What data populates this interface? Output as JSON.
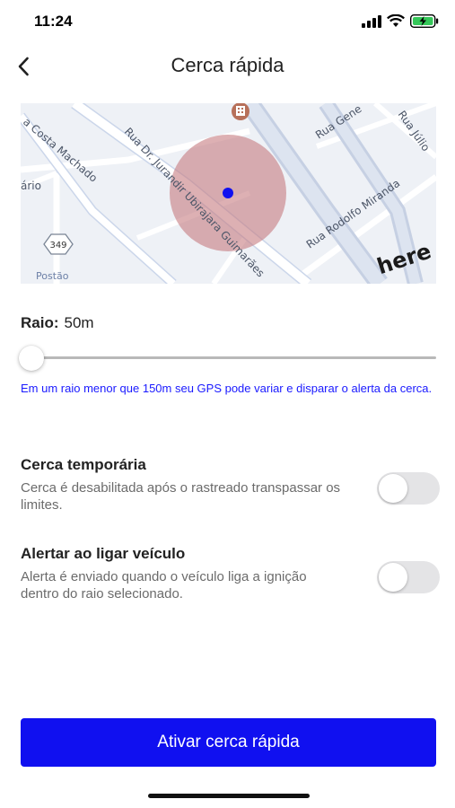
{
  "status": {
    "time": "11:24"
  },
  "header": {
    "title": "Cerca rápida"
  },
  "map": {
    "streets": {
      "costa_machado": "a Costa Machado",
      "jurandir": "Rua Dr. Jurandir Ubirajara Guimarães",
      "genebra": "Rua Gene",
      "julio": "Rua Júlio",
      "rodolfo": "Rua Rodolfo Miranda",
      "rosario": "ário",
      "postao": "Postão",
      "route": "349"
    },
    "brand": "here",
    "colors": {
      "fence_fill": "#c77b80",
      "marker": "#1010f0"
    }
  },
  "radius": {
    "label": "Raio:",
    "value": "50m",
    "slider_fraction": 0.0
  },
  "hint": "Em um raio menor que 150m seu GPS pode variar e disparar o alerta da cerca.",
  "options": [
    {
      "title": "Cerca temporária",
      "description": "Cerca é desabilitada após o rastreado transpassar os limites.",
      "enabled": false
    },
    {
      "title": "Alertar ao ligar veículo",
      "description": "Alerta é enviado quando o veículo liga a ignição dentro do raio selecionado.",
      "enabled": false
    }
  ],
  "action": {
    "label": "Ativar cerca rápida"
  },
  "colors": {
    "accent": "#1010f0",
    "hint_text": "#1a1aff"
  }
}
